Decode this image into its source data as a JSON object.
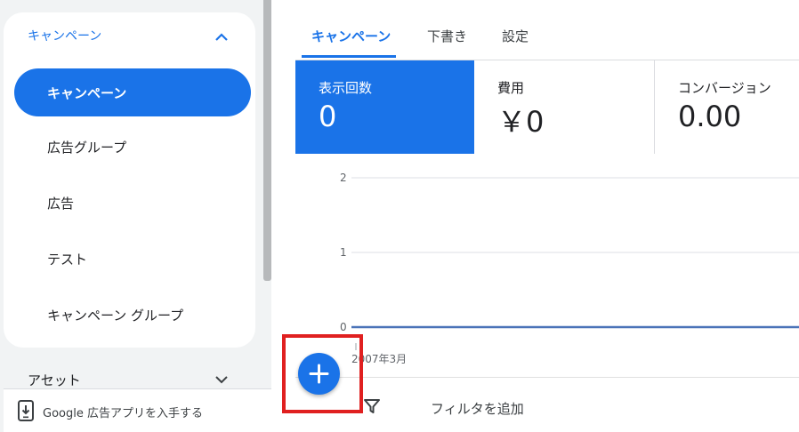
{
  "sidebar": {
    "section_title": "キャンペーン",
    "items": [
      {
        "label": "キャンペーン",
        "active": true
      },
      {
        "label": "広告グループ",
        "active": false
      },
      {
        "label": "広告",
        "active": false
      },
      {
        "label": "テスト",
        "active": false
      },
      {
        "label": "キャンペーン グループ",
        "active": false
      }
    ],
    "asset_label": "アセット",
    "app_promo_label": "Google 広告アプリを入手する"
  },
  "tabs": [
    {
      "label": "キャンペーン",
      "active": true
    },
    {
      "label": "下書き",
      "active": false
    },
    {
      "label": "設定",
      "active": false
    }
  ],
  "metrics": [
    {
      "label": "表示回数",
      "value": "0",
      "active": true
    },
    {
      "label": "費用",
      "value": "￥0",
      "active": false
    },
    {
      "label": "コンバージョン",
      "value": "0.00",
      "active": false
    }
  ],
  "chart_data": {
    "type": "line",
    "y_ticks": [
      "2",
      "1",
      "0"
    ],
    "ylim": [
      0,
      2
    ],
    "x_tick_label": "2007年3月",
    "series": [
      {
        "values": [
          0,
          0
        ]
      }
    ],
    "series_color": "#4a73b8"
  },
  "filter": {
    "label": "フィルタを追加"
  },
  "colors": {
    "accent": "#1a73e8",
    "highlight": "#e02020"
  }
}
